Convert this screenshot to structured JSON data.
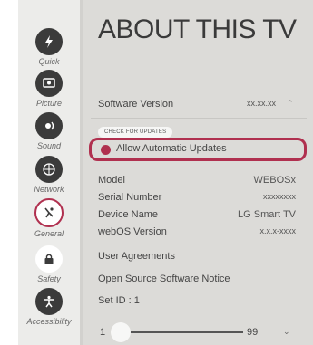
{
  "title": "ABOUT THIS TV",
  "sidebar": {
    "items": [
      {
        "label": "Quick",
        "icon": "quick-icon"
      },
      {
        "label": "Picture",
        "icon": "picture-icon"
      },
      {
        "label": "Sound",
        "icon": "sound-icon"
      },
      {
        "label": "Network",
        "icon": "network-icon"
      },
      {
        "label": "General",
        "icon": "general-icon"
      },
      {
        "label": "Safety",
        "icon": "lock-icon"
      },
      {
        "label": "Accessibility",
        "icon": "accessibility-icon"
      }
    ],
    "selected": "General"
  },
  "software": {
    "label": "Software Version",
    "value": "xx.xx.xx",
    "check_button": "CHECK FOR UPDATES",
    "auto_updates_label": "Allow Automatic Updates"
  },
  "info": [
    {
      "label": "Model",
      "value": "WEBOSx"
    },
    {
      "label": "Serial Number",
      "value": "xxxxxxxx"
    },
    {
      "label": "Device Name",
      "value": "LG Smart TV"
    },
    {
      "label": "webOS Version",
      "value": "x.x.x-xxxx"
    }
  ],
  "links": {
    "user_agreements": "User Agreements",
    "open_source": "Open Source Software Notice",
    "set_id": "Set ID : 1"
  },
  "slider": {
    "min": "1",
    "max": "99",
    "value": 1
  },
  "colors": {
    "accent": "#b0304f",
    "icon_bg": "#3b3b3b"
  }
}
